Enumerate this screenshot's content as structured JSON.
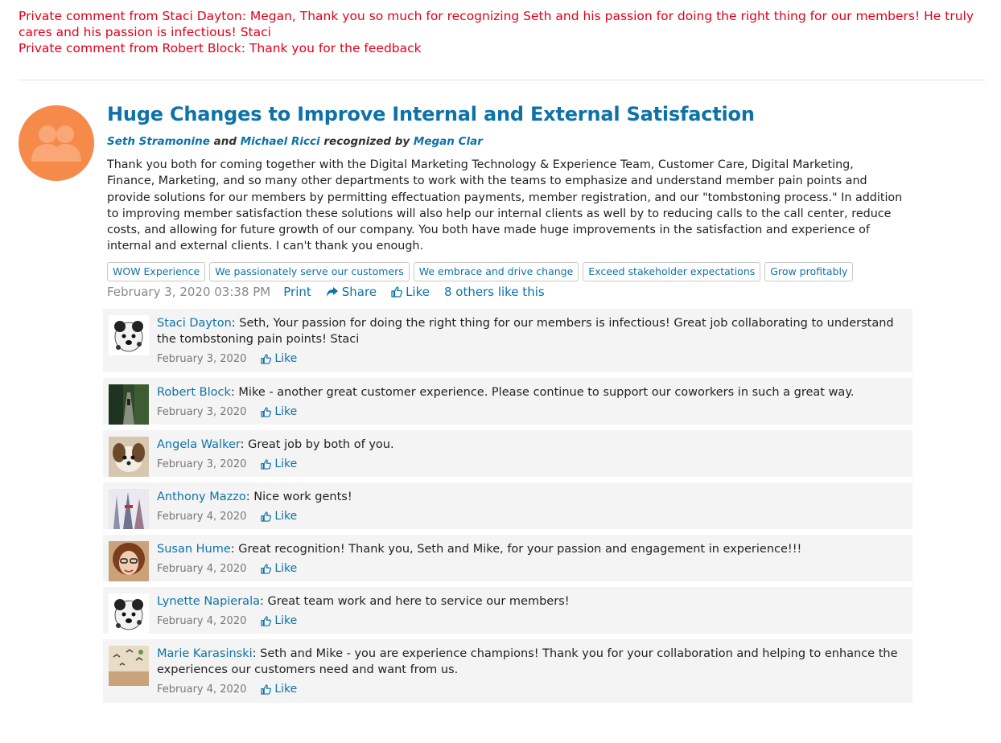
{
  "private_comments": [
    "Private comment from Staci Dayton: Megan, Thank you so much for recognizing Seth and his passion for doing the right thing for our members! He truly cares and his passion is infectious! Staci",
    "Private comment from Robert Block: Thank you for the feedback"
  ],
  "post": {
    "title": "Huge Changes to Improve Internal and External Satisfaction",
    "recipient_1": "Seth Stramonine",
    "and_word": "and",
    "recipient_2": "Michael Ricci",
    "recognized_by_word": "recognized by",
    "recognizer": "Megan Clar",
    "body": "Thank you both for coming together with the Digital Marketing Technology & Experience Team, Customer Care, Digital Marketing, Finance, Marketing, and so many other departments to work with the teams to emphasize and understand member pain points and provide solutions for our members by permitting effectuation payments, member registration, and our \"tombstoning process.\" In addition to improving member satisfaction these solutions will also help our internal clients as well by to reducing calls to the call center, reduce costs, and allowing for future growth of our company. You both have made huge improvements in the satisfaction and experience of internal and external clients. I can't thank you enough.",
    "tags": [
      "WOW Experience",
      "We passionately serve our customers",
      "We embrace and drive change",
      "Exceed stakeholder expectations",
      "Grow profitably"
    ],
    "date": "February 3, 2020 03:38 PM",
    "print_label": "Print",
    "share_label": "Share",
    "like_label": "Like",
    "likes_summary": "8 others like this",
    "icons": {
      "share": "share-arrow-icon",
      "like": "thumbs-up-icon",
      "avatar": "group-avatar-icon"
    }
  },
  "comments": [
    {
      "name": "Staci Dayton",
      "text": ": Seth, Your passion for doing the right thing for our members is infectious! Great job collaborating to understand the tombstoning pain points! Staci",
      "date": "February 3, 2020",
      "like": "Like"
    },
    {
      "name": "Robert Block",
      "text": ": Mike - another great customer experience. Please continue to support our coworkers in such a great way.",
      "date": "February 3, 2020",
      "like": "Like"
    },
    {
      "name": "Angela Walker",
      "text": ": Great job by both of you.",
      "date": "February 3, 2020",
      "like": "Like"
    },
    {
      "name": "Anthony Mazzo",
      "text": ": Nice work gents!",
      "date": "February 4, 2020",
      "like": "Like"
    },
    {
      "name": "Susan Hume",
      "text": ": Great recognition! Thank you, Seth and Mike, for your passion and engagement in experience!!!",
      "date": "February 4, 2020",
      "like": "Like"
    },
    {
      "name": "Lynette Napierala",
      "text": ": Great team work and here to service our members!",
      "date": "February 4, 2020",
      "like": "Like"
    },
    {
      "name": "Marie Karasinski",
      "text": ": Seth and Mike - you are experience champions! Thank you for your collaboration and helping to enhance the experiences our customers need and want from us.",
      "date": "February 4, 2020",
      "like": "Like"
    }
  ],
  "colors": {
    "link": "#0e72a8",
    "private": "#e3001b",
    "avatar": "#f58a4b"
  }
}
